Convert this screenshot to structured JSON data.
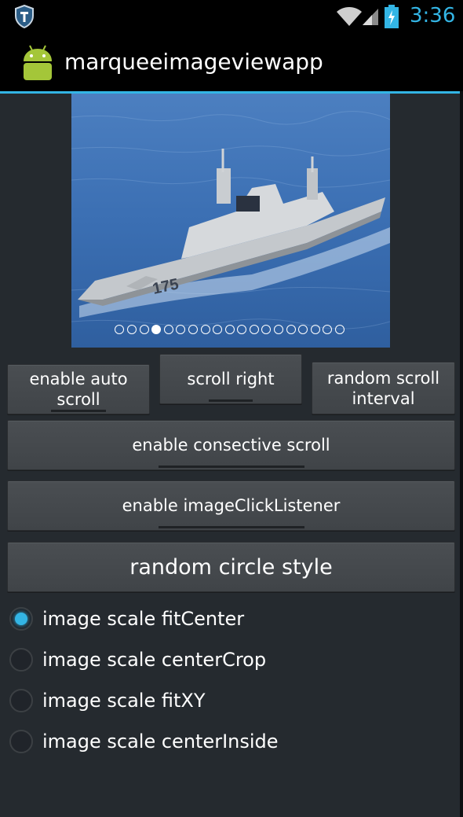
{
  "status_bar": {
    "time": "3:36",
    "icons": [
      "shield-icon",
      "wifi-icon",
      "signal-icon",
      "battery-charging-icon"
    ],
    "accent": "#33b5e5"
  },
  "action_bar": {
    "title": "marqueeimageviewapp",
    "icon": "android-robot-icon"
  },
  "marquee": {
    "dot_count": 19,
    "active_index": 3
  },
  "buttons": {
    "enable_auto_scroll": "enable auto scroll",
    "scroll_right": "scroll right",
    "random_scroll_interval": "random scroll interval",
    "enable_consective_scroll": "enable consective scroll",
    "enable_image_click_listener": "enable imageClickListener",
    "random_circle_style": "random circle style"
  },
  "radios": [
    {
      "label": "image scale fitCenter",
      "checked": true
    },
    {
      "label": "image scale centerCrop",
      "checked": false
    },
    {
      "label": "image scale fitXY",
      "checked": false
    },
    {
      "label": "image scale centerInside",
      "checked": false
    }
  ]
}
